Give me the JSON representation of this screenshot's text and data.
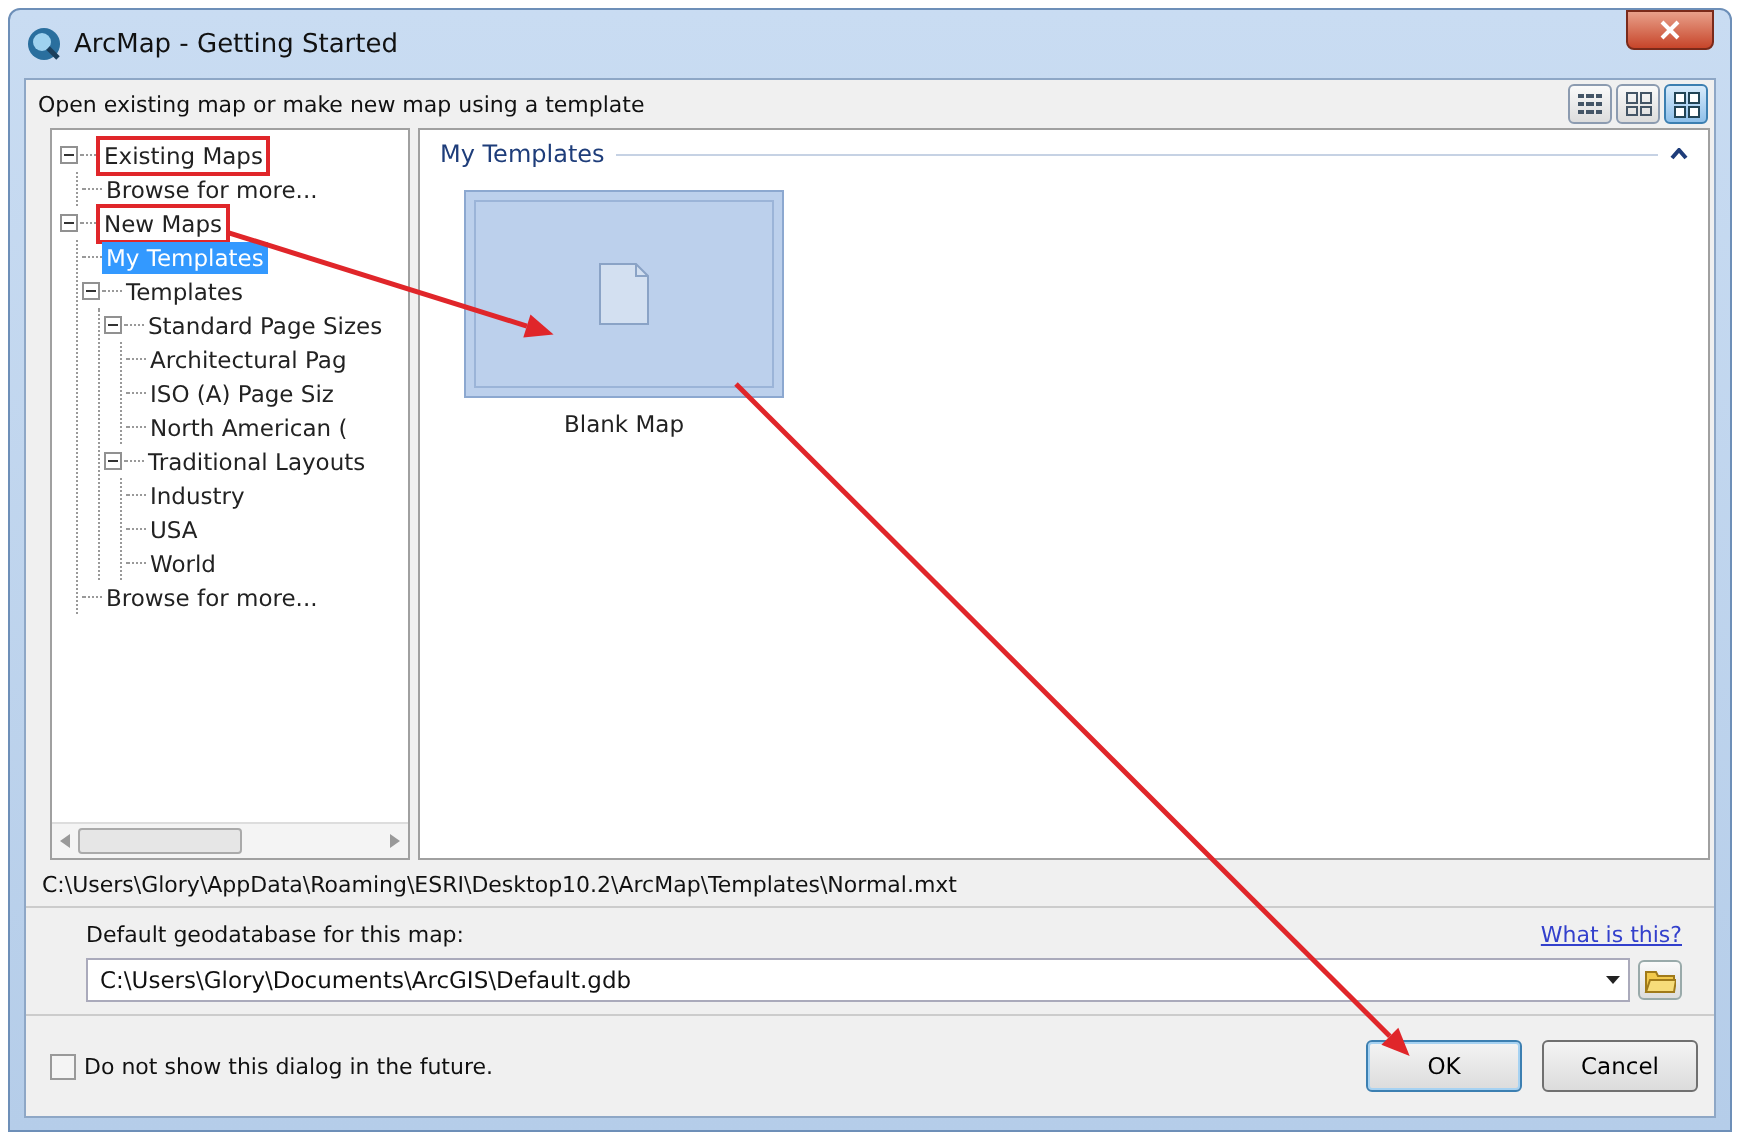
{
  "window": {
    "title": "ArcMap - Getting Started"
  },
  "subtitle": "Open existing map or make new map using a template",
  "view_buttons": [
    {
      "kind": "details",
      "selected": false
    },
    {
      "kind": "list",
      "selected": false
    },
    {
      "kind": "tiles",
      "selected": true
    }
  ],
  "tree": [
    {
      "label": "Existing Maps",
      "expanded": true,
      "selected": false,
      "highlighted": true,
      "children": [
        {
          "label": "Browse for more...",
          "selected": false,
          "highlighted": false
        }
      ]
    },
    {
      "label": "New Maps",
      "expanded": true,
      "selected": false,
      "highlighted": true,
      "children": [
        {
          "label": "My Templates",
          "selected": true,
          "highlighted": false
        },
        {
          "label": "Templates",
          "expanded": true,
          "selected": false,
          "highlighted": false,
          "children": [
            {
              "label": "Standard Page Sizes",
              "expanded": true,
              "selected": false,
              "highlighted": false,
              "children": [
                {
                  "label": "Architectural Pag",
                  "selected": false,
                  "highlighted": false
                },
                {
                  "label": "ISO (A) Page Siz",
                  "selected": false,
                  "highlighted": false
                },
                {
                  "label": "North American (",
                  "selected": false,
                  "highlighted": false
                }
              ]
            },
            {
              "label": "Traditional Layouts",
              "expanded": true,
              "selected": false,
              "highlighted": false,
              "children": [
                {
                  "label": "Industry",
                  "selected": false,
                  "highlighted": false
                },
                {
                  "label": "USA",
                  "selected": false,
                  "highlighted": false
                },
                {
                  "label": "World",
                  "selected": false,
                  "highlighted": false
                }
              ]
            }
          ]
        },
        {
          "label": "Browse for more...",
          "selected": false,
          "highlighted": false
        }
      ]
    }
  ],
  "section": {
    "title": "My Templates",
    "expanded": true
  },
  "templates": [
    {
      "label": "Blank Map",
      "selected": true
    }
  ],
  "template_path": "C:\\Users\\Glory\\AppData\\Roaming\\ESRI\\Desktop10.2\\ArcMap\\Templates\\Normal.mxt",
  "geodatabase": {
    "label": "Default geodatabase for this map:",
    "link": "What is this?",
    "value": "C:\\Users\\Glory\\Documents\\ArcGIS\\Default.gdb"
  },
  "dont_show": {
    "label": "Do not show this dialog in the future.",
    "checked": false
  },
  "buttons": [
    {
      "label": "OK",
      "default": true
    },
    {
      "label": "Cancel",
      "default": false
    }
  ]
}
